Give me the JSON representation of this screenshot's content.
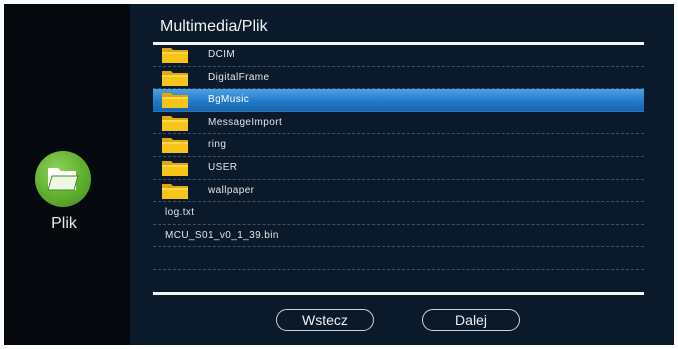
{
  "sidebar": {
    "icon": "folder-icon",
    "label": "Plik",
    "accent": "#5fae2f"
  },
  "main": {
    "path": "Multimedia/Plik",
    "items": [
      {
        "type": "folder",
        "name": "DCIM"
      },
      {
        "type": "folder",
        "name": "DigitalFrame"
      },
      {
        "type": "folder",
        "name": "BgMusic",
        "selected": true
      },
      {
        "type": "folder",
        "name": "MessageImport"
      },
      {
        "type": "folder",
        "name": "ring"
      },
      {
        "type": "folder",
        "name": "USER"
      },
      {
        "type": "folder",
        "name": "wallpaper"
      },
      {
        "type": "file",
        "name": "log.txt"
      },
      {
        "type": "file",
        "name": "MCU_S01_v0_1_39.bin"
      },
      {
        "type": "empty",
        "name": ""
      },
      {
        "type": "empty",
        "name": ""
      }
    ],
    "colors": {
      "selection": "#1f78c8",
      "folder": "#f5c518",
      "background": "#0a1a2b"
    }
  },
  "buttons": {
    "back": "Wstecz",
    "next": "Dalej"
  }
}
